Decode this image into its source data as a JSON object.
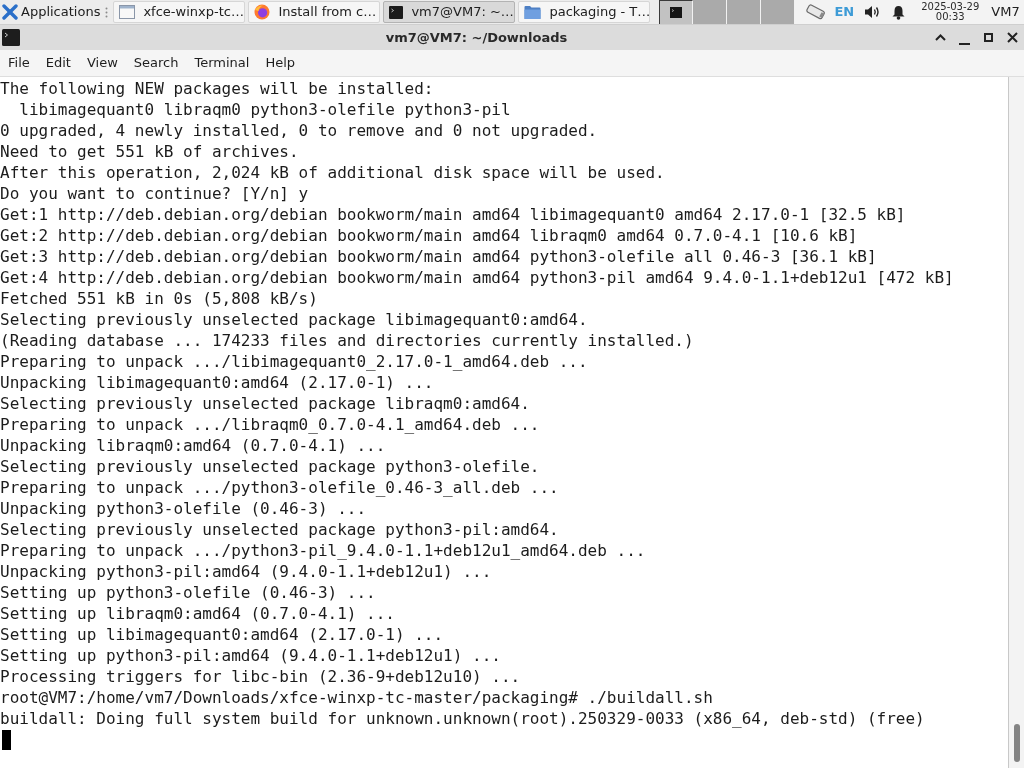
{
  "taskbar": {
    "applications": {
      "label": "Applications"
    },
    "windows": [
      {
        "title": "xfce-winxp-tc…",
        "kind": "window",
        "selected": false
      },
      {
        "title": "Install from c…",
        "kind": "browser",
        "selected": false
      },
      {
        "title": "vm7@VM7: ~…",
        "kind": "terminal",
        "selected": true
      },
      {
        "title": "packaging - T…",
        "kind": "folder",
        "selected": false
      }
    ],
    "workspaces": [
      {
        "selected": true,
        "has_window": true
      },
      {
        "selected": false,
        "has_window": false
      },
      {
        "selected": false,
        "has_window": false
      },
      {
        "selected": false,
        "has_window": false
      }
    ],
    "tray": {
      "keyboard_layout": "EN",
      "date": "2025-03-29",
      "time": "00:33",
      "user": "VM7"
    }
  },
  "window": {
    "title": "vm7@VM7: ~/Downloads",
    "menu": [
      "File",
      "Edit",
      "View",
      "Search",
      "Terminal",
      "Help"
    ]
  },
  "terminal": {
    "lines": [
      "The following NEW packages will be installed:",
      "  libimagequant0 libraqm0 python3-olefile python3-pil",
      "0 upgraded, 4 newly installed, 0 to remove and 0 not upgraded.",
      "Need to get 551 kB of archives.",
      "After this operation, 2,024 kB of additional disk space will be used.",
      "Do you want to continue? [Y/n] y",
      "Get:1 http://deb.debian.org/debian bookworm/main amd64 libimagequant0 amd64 2.17.0-1 [32.5 kB]",
      "Get:2 http://deb.debian.org/debian bookworm/main amd64 libraqm0 amd64 0.7.0-4.1 [10.6 kB]",
      "Get:3 http://deb.debian.org/debian bookworm/main amd64 python3-olefile all 0.46-3 [36.1 kB]",
      "Get:4 http://deb.debian.org/debian bookworm/main amd64 python3-pil amd64 9.4.0-1.1+deb12u1 [472 kB]",
      "Fetched 551 kB in 0s (5,808 kB/s)",
      "Selecting previously unselected package libimagequant0:amd64.",
      "(Reading database ... 174233 files and directories currently installed.)",
      "Preparing to unpack .../libimagequant0_2.17.0-1_amd64.deb ...",
      "Unpacking libimagequant0:amd64 (2.17.0-1) ...",
      "Selecting previously unselected package libraqm0:amd64.",
      "Preparing to unpack .../libraqm0_0.7.0-4.1_amd64.deb ...",
      "Unpacking libraqm0:amd64 (0.7.0-4.1) ...",
      "Selecting previously unselected package python3-olefile.",
      "Preparing to unpack .../python3-olefile_0.46-3_all.deb ...",
      "Unpacking python3-olefile (0.46-3) ...",
      "Selecting previously unselected package python3-pil:amd64.",
      "Preparing to unpack .../python3-pil_9.4.0-1.1+deb12u1_amd64.deb ...",
      "Unpacking python3-pil:amd64 (9.4.0-1.1+deb12u1) ...",
      "Setting up python3-olefile (0.46-3) ...",
      "Setting up libraqm0:amd64 (0.7.0-4.1) ...",
      "Setting up libimagequant0:amd64 (2.17.0-1) ...",
      "Setting up python3-pil:amd64 (9.4.0-1.1+deb12u1) ...",
      "Processing triggers for libc-bin (2.36-9+deb12u10) ...",
      "root@VM7:/home/vm7/Downloads/xfce-winxp-tc-master/packaging# ./buildall.sh",
      "buildall: Doing full system build for unknown.unknown(root).250329-0033 (x86_64, deb-std) (free)"
    ]
  }
}
